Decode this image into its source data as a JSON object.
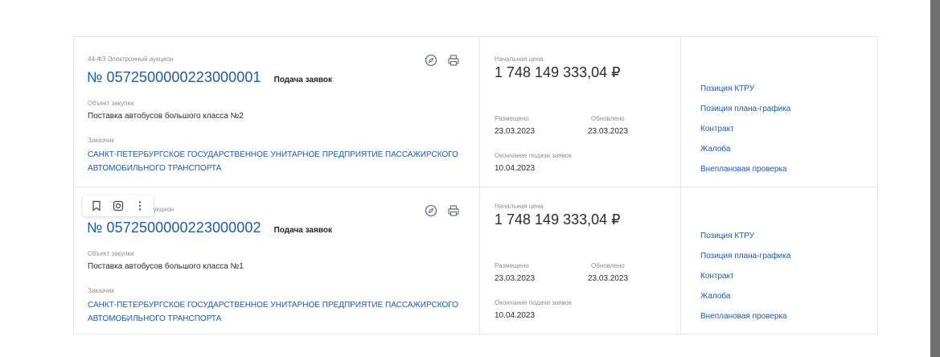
{
  "cards": [
    {
      "procedure_type": "44-ФЗ Электронный аукцион",
      "reg_number": "№ 0572500000223000001",
      "status": "Подача заявок",
      "object_label": "Объект закупки",
      "object_value": "Поставка автобусов большого класса №2",
      "customer_label": "Заказчик",
      "customer_value": "САНКТ-ПЕТЕРБУРГСКОЕ ГОСУДАРСТВЕННОЕ УНИТАРНОЕ ПРЕДПРИЯТИЕ ПАССАЖИРСКОГО АВТОМОБИЛЬНОГО ТРАНСПОРТА",
      "price_label": "Начальная цена",
      "price_value": "1 748 149 333,04 ₽",
      "placed_label": "Размещено",
      "placed_value": "23.03.2023",
      "updated_label": "Обновлено",
      "updated_value": "23.03.2023",
      "deadline_label": "Окончание подачи заявок",
      "deadline_value": "10.04.2023",
      "links": [
        "Позиция КТРУ",
        "Позиция плана-графика",
        "Контракт",
        "Жалоба",
        "Внеплановая проверка"
      ]
    },
    {
      "procedure_type": "ый аукцион",
      "reg_number": "№ 0572500000223000002",
      "status": "Подача заявок",
      "object_label": "Объект закупки",
      "object_value": "Поставка автобусов большого класса №1",
      "customer_label": "Заказчик",
      "customer_value": "САНКТ-ПЕТЕРБУРГСКОЕ ГОСУДАРСТВЕННОЕ УНИТАРНОЕ ПРЕДПРИЯТИЕ ПАССАЖИРСКОГО АВТОМОБИЛЬНОГО ТРАНСПОРТА",
      "price_label": "Начальная цена",
      "price_value": "1 748 149 333,04 ₽",
      "placed_label": "Размещено",
      "placed_value": "23.03.2023",
      "updated_label": "Обновлено",
      "updated_value": "23.03.2023",
      "deadline_label": "Окончание подачи заявок",
      "deadline_value": "10.04.2023",
      "links": [
        "Позиция КТРУ",
        "Позиция плана-графика",
        "Контракт",
        "Жалоба",
        "Внеплановая проверка"
      ]
    }
  ],
  "hover_toolbar": {
    "icons": [
      "bookmark-icon",
      "screenshot-icon",
      "more-vertical-icon"
    ]
  },
  "icons": {
    "compass": "compass-icon",
    "print": "print-icon"
  },
  "colors": {
    "link": "#1f5aa6",
    "muted": "#8a8f96",
    "border": "#e3e6ea"
  }
}
